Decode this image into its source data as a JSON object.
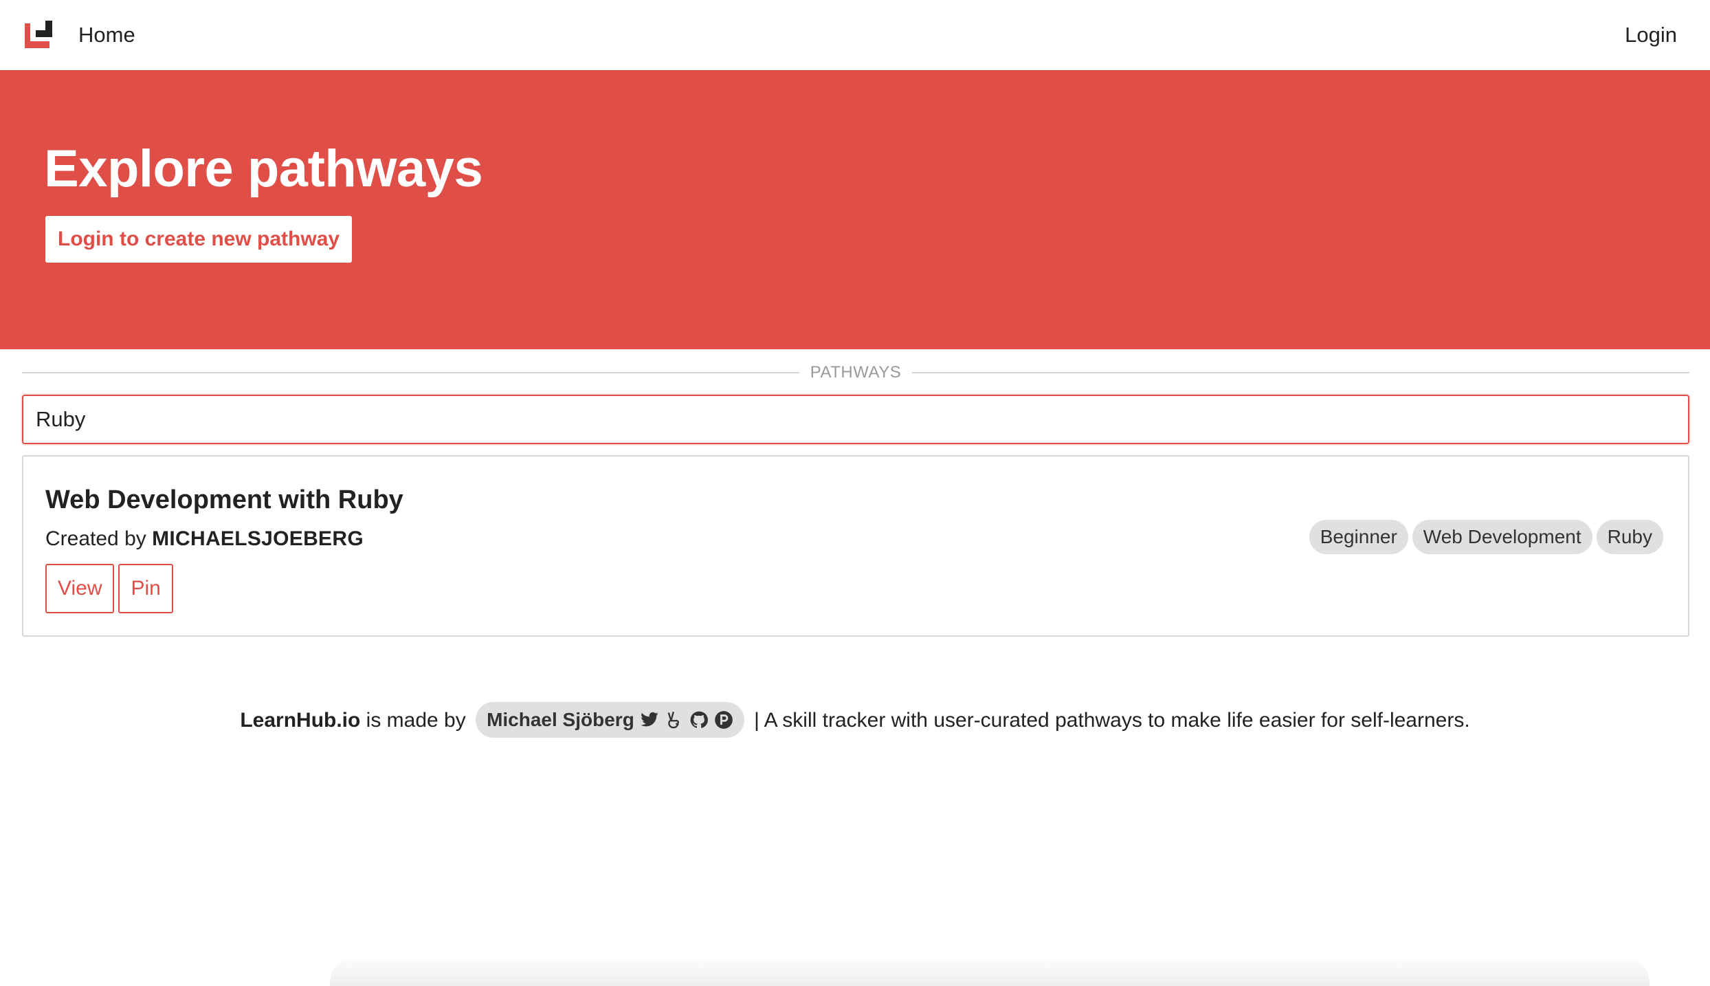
{
  "nav": {
    "home_label": "Home",
    "login_label": "Login"
  },
  "hero": {
    "title": "Explore pathways",
    "cta_label": "Login to create new pathway"
  },
  "section": {
    "divider_label": "PATHWAYS"
  },
  "search": {
    "value": "Ruby",
    "placeholder": ""
  },
  "results": [
    {
      "title": "Web Development with Ruby",
      "created_by_prefix": "Created by ",
      "creator": "MICHAELSJOEBERG",
      "actions": {
        "view_label": "View",
        "pin_label": "Pin"
      },
      "tags": [
        "Beginner",
        "Web Development",
        "Ruby"
      ]
    }
  ],
  "footer": {
    "brand": "LearnHub.io",
    "made_by": " is made by ",
    "author": "Michael Sjöberg",
    "social_icons": [
      "twitter-icon",
      "peace-hand-icon",
      "github-icon",
      "patreon-icon"
    ],
    "tagline": " | A skill tracker with user-curated pathways to make life easier for self-learners."
  },
  "colors": {
    "accent": "#e04e48",
    "tag_bg": "#e0e0e0",
    "divider": "#d4d4d4"
  }
}
